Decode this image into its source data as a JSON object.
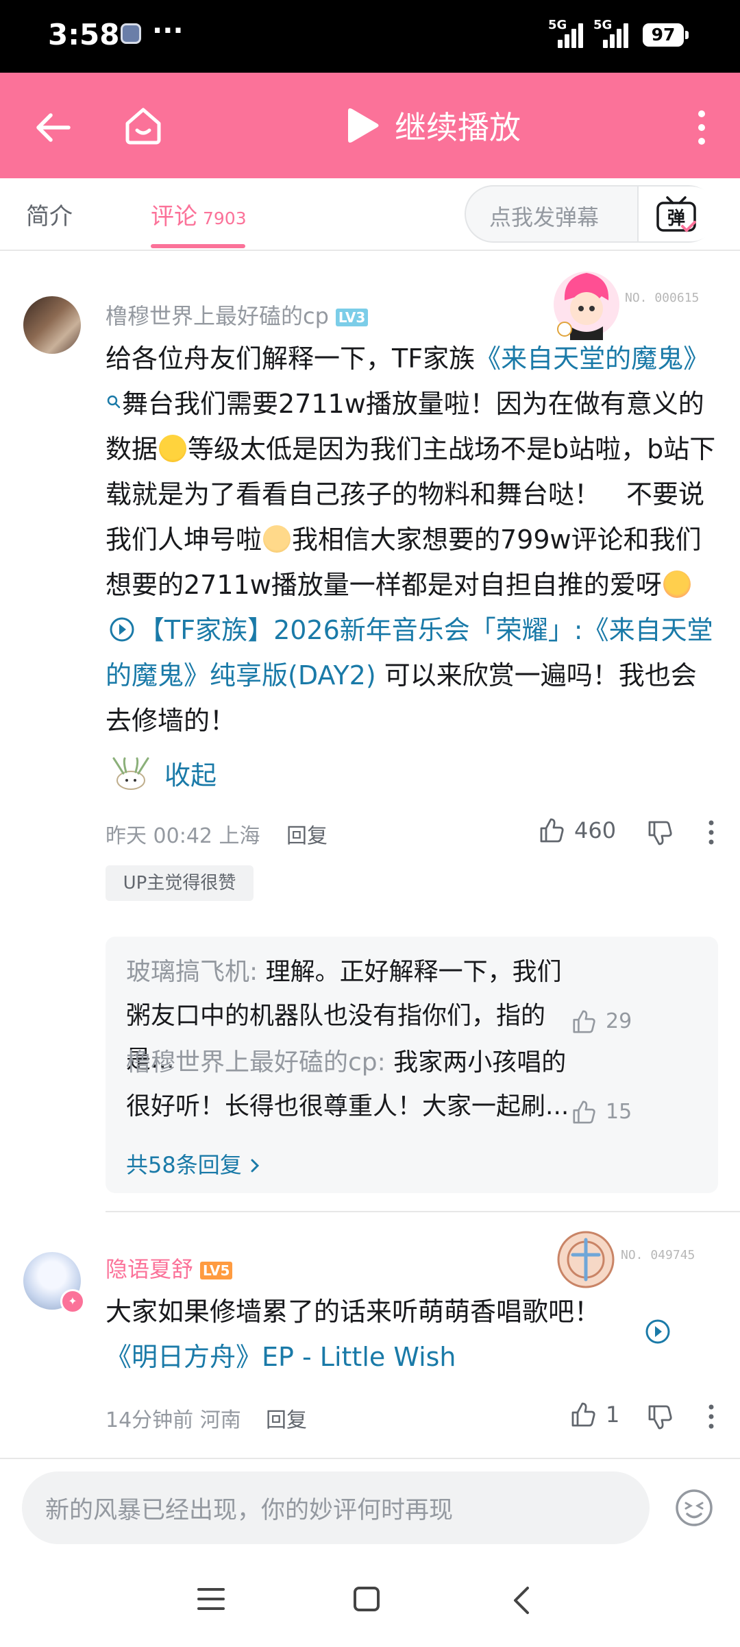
{
  "status_bar": {
    "time": "3:58",
    "dots": "···",
    "signal1": "5G",
    "signal2": "5G",
    "battery": "97"
  },
  "topbar": {
    "continue_label": "继续播放"
  },
  "tabs": {
    "intro": "简介",
    "comments": "评论",
    "comment_count": "7903"
  },
  "danmaku": {
    "placeholder": "点我发弹幕",
    "button_label": "弹"
  },
  "comments": [
    {
      "username": "橹穆世界上最好磕的cp",
      "level": "LV3",
      "fan_number": "NO. 000615",
      "body": {
        "p1": "给各位舟友们解释一下，TF家族",
        "link1": "《来自天堂的魔鬼》",
        "p2": "舞台我们需要2711w播放量啦！因为在做有意义的数据",
        "p3": "等级太低是因为我们主战场不是b站啦，b站下载就是为了看看自己孩子的物料和舞台哒！　不要说我们人坤号啦",
        "p4": "我相信大家想要的799w评论和我们想要的2711w播放量一样都是对自担自推的爱呀",
        "link2": "【TF家族】2026新年音乐会「荣耀」:《来自天堂的魔鬼》纯享版(DAY2)",
        "p5": "可以来欣赏一遍吗！我也会去修墙的！"
      },
      "collapse_label": "收起",
      "time": "昨天 00:42",
      "location": "上海",
      "reply_label": "回复",
      "likes": "460",
      "badge": "UP主觉得很赞",
      "replies": [
        {
          "name": "玻璃搞飞机",
          "text": "理解。正好解释一下，我们粥友口中的机器队也没有指你们，指的是...",
          "likes": "29"
        },
        {
          "name": "橹穆世界上最好磕的cp",
          "text": "我家两小孩唱的很好听！长得也很尊重人！大家一起刷...",
          "likes": "15"
        }
      ],
      "total_replies": "共58条回复"
    },
    {
      "username": "隐语夏舒",
      "level": "LV5",
      "fan_number": "NO. 049745",
      "body": {
        "p1": "大家如果修墙累了的话来听萌萌香唱歌吧！",
        "link1": "《明日方舟》EP - Little Wish"
      },
      "time": "14分钟前",
      "location": "河南",
      "reply_label": "回复",
      "likes": "1"
    }
  ],
  "bottom": {
    "input_placeholder": "新的风暴已经出现，你的妙评何时再现"
  },
  "colors": {
    "brand_pink": "#fb7299",
    "link_blue": "#1a7aa8",
    "level3": "#7bcde8",
    "level5": "#ff9b40"
  }
}
